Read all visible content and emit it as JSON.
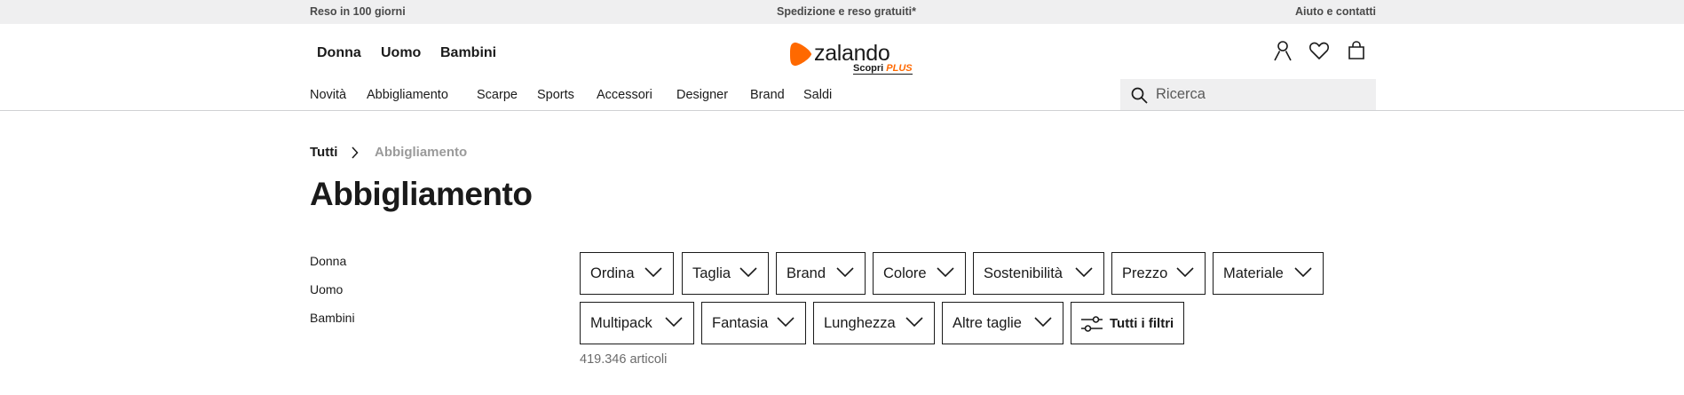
{
  "topbar": {
    "left": "Reso in 100 giorni",
    "center": "Spedizione e reso gratuiti*",
    "right": "Aiuto e contatti"
  },
  "header": {
    "genders": [
      "Donna",
      "Uomo",
      "Bambini"
    ],
    "logo": {
      "word": "zalando",
      "sub_prefix": "Scopri ",
      "sub_plus": "PLUS",
      "brand_color": "#ff6900"
    },
    "icons": [
      "user-icon",
      "heart-icon",
      "bag-icon"
    ],
    "categories": [
      "Novità",
      "Abbigliamento",
      "Scarpe",
      "Sports",
      "Accessori",
      "Designer",
      "Brand",
      "Saldi"
    ],
    "search": {
      "placeholder": "Ricerca",
      "value": ""
    }
  },
  "breadcrumb": {
    "root": "Tutti",
    "current": "Abbigliamento"
  },
  "page_title": "Abbigliamento",
  "sidebar": {
    "items": [
      "Donna",
      "Uomo",
      "Bambini"
    ]
  },
  "filters": {
    "row1": [
      "Ordina",
      "Taglia",
      "Brand",
      "Colore",
      "Sostenibilità",
      "Prezzo",
      "Materiale"
    ],
    "row2": [
      "Multipack",
      "Fantasia",
      "Lunghezza",
      "Altre taglie"
    ],
    "all_filters": "Tutti i filtri"
  },
  "results_count": "419.346 articoli"
}
